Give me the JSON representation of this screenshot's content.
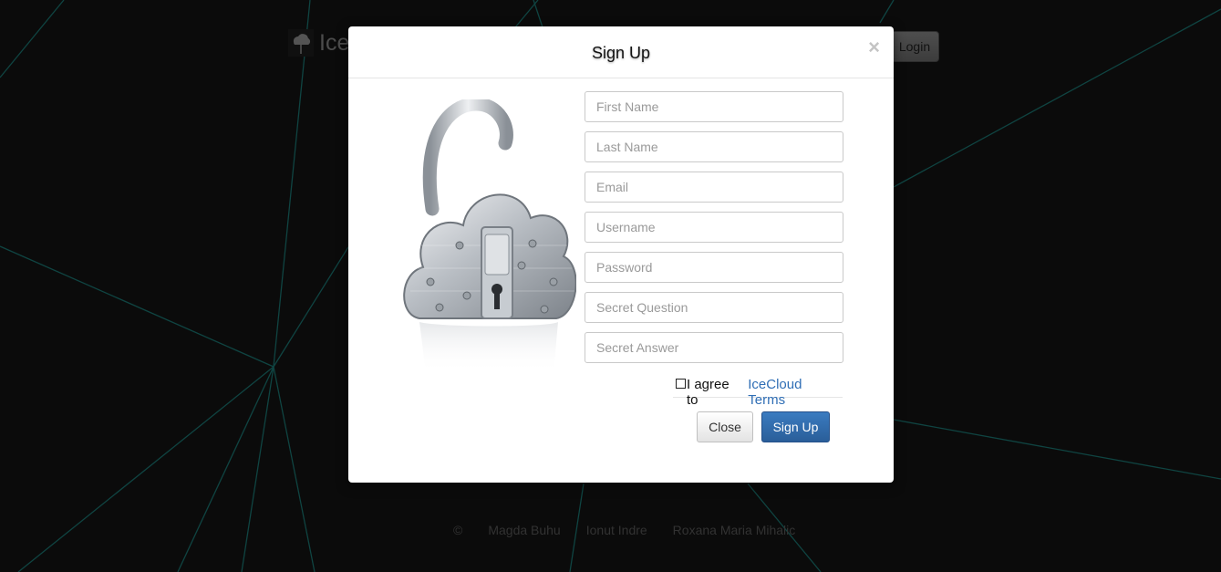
{
  "page": {
    "brand_text": "Ice",
    "login_label": "Login",
    "footer": [
      "©",
      "Magda Buhu",
      "Ionut Indre",
      "Roxana Maria Mihalic"
    ]
  },
  "modal": {
    "title": "Sign Up",
    "close_symbol": "×",
    "fields": {
      "first_name": "First Name",
      "last_name": "Last Name",
      "email": "Email",
      "username": "Username",
      "password": "Password",
      "secret_question": "Secret Question",
      "secret_answer": "Secret Answer"
    },
    "agree_text": "I agree to",
    "terms_link": "IceCloud Terms",
    "close_button": "Close",
    "signup_button": "Sign Up"
  },
  "colors": {
    "background": "#141414",
    "lines": "#1f8f8a",
    "primary": "#2f6eb5"
  },
  "icons": [
    "cloud-logo-icon",
    "cloud-padlock-image",
    "close-icon"
  ]
}
